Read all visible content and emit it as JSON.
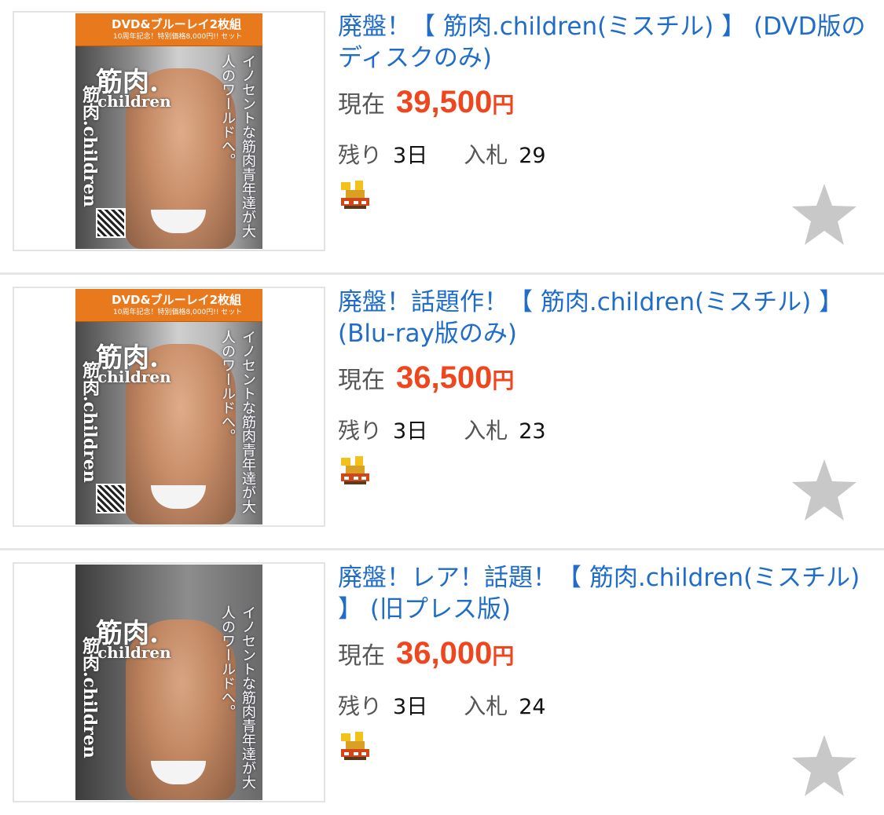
{
  "items": [
    {
      "title": "廃盤！【 筋肉.children(ミスチル) 】 (DVD版のディスクのみ)",
      "price_label": "現在",
      "price": "39,500",
      "price_unit": "円",
      "remaining_label": "残り",
      "remaining": "3日",
      "bids_label": "入札",
      "bids": "29",
      "cover": {
        "band_text": "DVD&ブルーレイ2枚組",
        "band_sub": "10周年記念！特別価格8,000円!! セット",
        "title_big": "筋肉.",
        "title_sub": "children",
        "vertical_left": "筋肉.children",
        "vertical_right": "イノセントな筋肉青年達が大人のワールドへ。"
      }
    },
    {
      "title": "廃盤！話題作！【 筋肉.children(ミスチル) 】 (Blu-ray版のみ)",
      "price_label": "現在",
      "price": "36,500",
      "price_unit": "円",
      "remaining_label": "残り",
      "remaining": "3日",
      "bids_label": "入札",
      "bids": "23",
      "cover": {
        "band_text": "DVD&ブルーレイ2枚組",
        "band_sub": "10周年記念！特別価格8,000円!! セット",
        "title_big": "筋肉.",
        "title_sub": "children",
        "vertical_left": "筋肉.children",
        "vertical_right": "イノセントな筋肉青年達が大人のワールドへ。"
      }
    },
    {
      "title": "廃盤！レア！話題！【 筋肉.children(ミスチル) 】 (旧プレス版)",
      "price_label": "現在",
      "price": "36,000",
      "price_unit": "円",
      "remaining_label": "残り",
      "remaining": "3日",
      "bids_label": "入札",
      "bids": "24",
      "cover": {
        "band_text": "",
        "band_sub": "",
        "title_big": "筋肉.",
        "title_sub": "children",
        "vertical_left": "筋肉.children",
        "vertical_right": "イノセントな筋肉青年達が大人のワールドへ。"
      }
    }
  ],
  "icons": {
    "badge": "new-item-badge-icon",
    "watch": "star-icon"
  },
  "colors": {
    "title_link": "#1f6dc8",
    "price": "#f0461e",
    "star": "#c8c8c8",
    "separator": "#e6e6e6"
  }
}
